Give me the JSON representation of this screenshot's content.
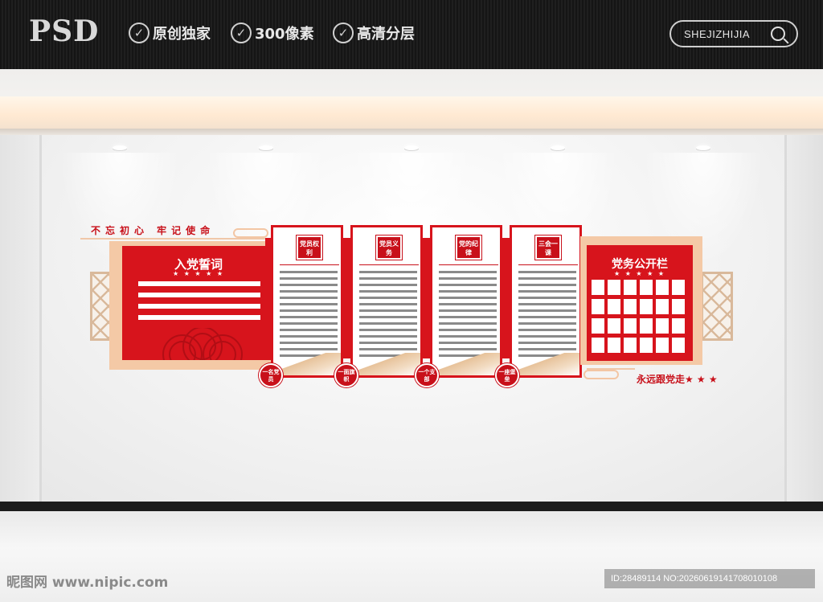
{
  "header": {
    "logo": "PSD",
    "features": [
      {
        "icon": "check-circle-icon",
        "label": "原创独家"
      },
      {
        "icon": "check-circle-icon",
        "label": "300像素"
      },
      {
        "icon": "check-circle-icon",
        "label": "高清分层"
      }
    ],
    "search_text": "SHEJIZHIJIA",
    "search_icon": "magnifier-icon"
  },
  "wall": {
    "slogan": "不忘初心 牢记使命",
    "oath_title": "入党誓词",
    "stars": "★ ★ ★ ★ ★",
    "panels": [
      {
        "badge": "党员权利"
      },
      {
        "badge": "党员义务"
      },
      {
        "badge": "党的纪律"
      },
      {
        "badge": "三会一课"
      }
    ],
    "circles": [
      "一名党员",
      "一面旗帜",
      "一个支部",
      "一座堡垒"
    ],
    "affairs_title": "党务公开栏",
    "follow": "永远跟党走★ ★ ★"
  },
  "footer": {
    "watermark": "昵图网 www.nipic.com",
    "id_text": "ID:28489114 NO:20260619141708010108"
  },
  "colors": {
    "accent": "#d7141c",
    "peach": "#f4c9a6",
    "topbar": "#1a1a1a"
  }
}
